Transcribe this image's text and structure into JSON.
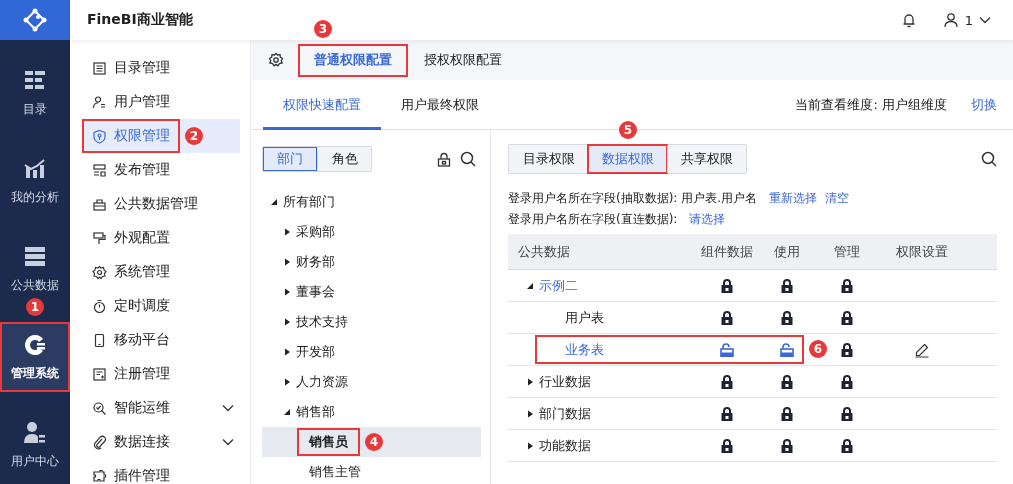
{
  "header": {
    "title": "FineBI商业智能",
    "user": "1"
  },
  "rail": [
    {
      "label": "目录",
      "selected": false
    },
    {
      "label": "我的分析",
      "selected": false
    },
    {
      "label": "公共数据",
      "selected": false
    },
    {
      "label": "管理系统",
      "selected": true,
      "outlined": true,
      "callout": "1"
    },
    {
      "label": "用户中心",
      "selected": false
    }
  ],
  "menu": [
    {
      "label": "目录管理",
      "selected": false
    },
    {
      "label": "用户管理",
      "selected": false
    },
    {
      "label": "权限管理",
      "selected": true,
      "outlined": true,
      "callout": "2"
    },
    {
      "label": "发布管理",
      "selected": false
    },
    {
      "label": "公共数据管理",
      "selected": false
    },
    {
      "label": "外观配置",
      "selected": false
    },
    {
      "label": "系统管理",
      "selected": false
    },
    {
      "label": "定时调度",
      "selected": false
    },
    {
      "label": "移动平台",
      "selected": false
    },
    {
      "label": "注册管理",
      "selected": false
    },
    {
      "label": "智能运维",
      "selected": false,
      "expanded": false
    },
    {
      "label": "数据连接",
      "selected": false,
      "expanded": false
    },
    {
      "label": "插件管理",
      "selected": false
    }
  ],
  "tabs": [
    {
      "label": "普通权限配置",
      "selected": true,
      "outlined": true,
      "callout": "3"
    },
    {
      "label": "授权权限配置",
      "selected": false
    }
  ],
  "subtabs": [
    {
      "label": "权限快速配置",
      "selected": true
    },
    {
      "label": "用户最终权限",
      "selected": false
    }
  ],
  "dimension": {
    "label": "当前查看维度: 用户组维度",
    "link": "切换"
  },
  "tree_switch": [
    {
      "label": "部门",
      "selected": true
    },
    {
      "label": "角色",
      "selected": false
    }
  ],
  "tree": [
    {
      "label": "所有部门",
      "expanded": true,
      "selected": false,
      "children": [
        {
          "label": "采购部",
          "expanded": false,
          "selected": false
        },
        {
          "label": "财务部",
          "expanded": false,
          "selected": false
        },
        {
          "label": "董事会",
          "expanded": false,
          "selected": false
        },
        {
          "label": "技术支持",
          "expanded": false,
          "selected": false
        },
        {
          "label": "开发部",
          "expanded": false,
          "selected": false
        },
        {
          "label": "人力资源",
          "expanded": false,
          "selected": false
        },
        {
          "label": "销售部",
          "expanded": true,
          "selected": false,
          "children": [
            {
              "label": "销售员",
              "selected": true,
              "outlined": true,
              "callout": "4"
            },
            {
              "label": "销售主管",
              "selected": false
            }
          ]
        }
      ]
    }
  ],
  "perm_tabs": [
    {
      "label": "目录权限",
      "selected": false
    },
    {
      "label": "数据权限",
      "selected": true,
      "outlined": true,
      "callout": "5"
    },
    {
      "label": "共享权限",
      "selected": false
    }
  ],
  "login_fields": [
    {
      "text": "登录用户名所在字段(抽取数据): 用户表.用户名",
      "links": [
        "重新选择",
        "清空"
      ]
    },
    {
      "text": "登录用户名所在字段(直连数据):",
      "links": [
        "请选择"
      ]
    }
  ],
  "table": {
    "columns": [
      "公共数据",
      "组件数据",
      "使用",
      "管理",
      "权限设置"
    ],
    "rows": [
      {
        "name": "示例二",
        "highlighted": true,
        "expanded": true,
        "locks": [
          {
            "locked": true
          },
          {
            "locked": true
          },
          {
            "locked": true
          }
        ],
        "children": [
          {
            "name": "用户表",
            "highlighted": false,
            "locks": [
              {
                "locked": true
              },
              {
                "locked": true
              },
              {
                "locked": true
              }
            ]
          },
          {
            "name": "业务表",
            "highlighted": true,
            "outlined": true,
            "callout": "6",
            "editable": true,
            "locks": [
              {
                "locked": false
              },
              {
                "locked": false
              },
              {
                "locked": true
              }
            ]
          }
        ]
      },
      {
        "name": "行业数据",
        "highlighted": false,
        "expanded": false,
        "locks": [
          {
            "locked": true
          },
          {
            "locked": true
          },
          {
            "locked": true
          }
        ]
      },
      {
        "name": "部门数据",
        "highlighted": false,
        "expanded": false,
        "locks": [
          {
            "locked": true
          },
          {
            "locked": true
          },
          {
            "locked": true
          }
        ]
      },
      {
        "name": "功能数据",
        "highlighted": false,
        "expanded": false,
        "locks": [
          {
            "locked": true
          },
          {
            "locked": true
          },
          {
            "locked": true
          }
        ]
      }
    ]
  }
}
